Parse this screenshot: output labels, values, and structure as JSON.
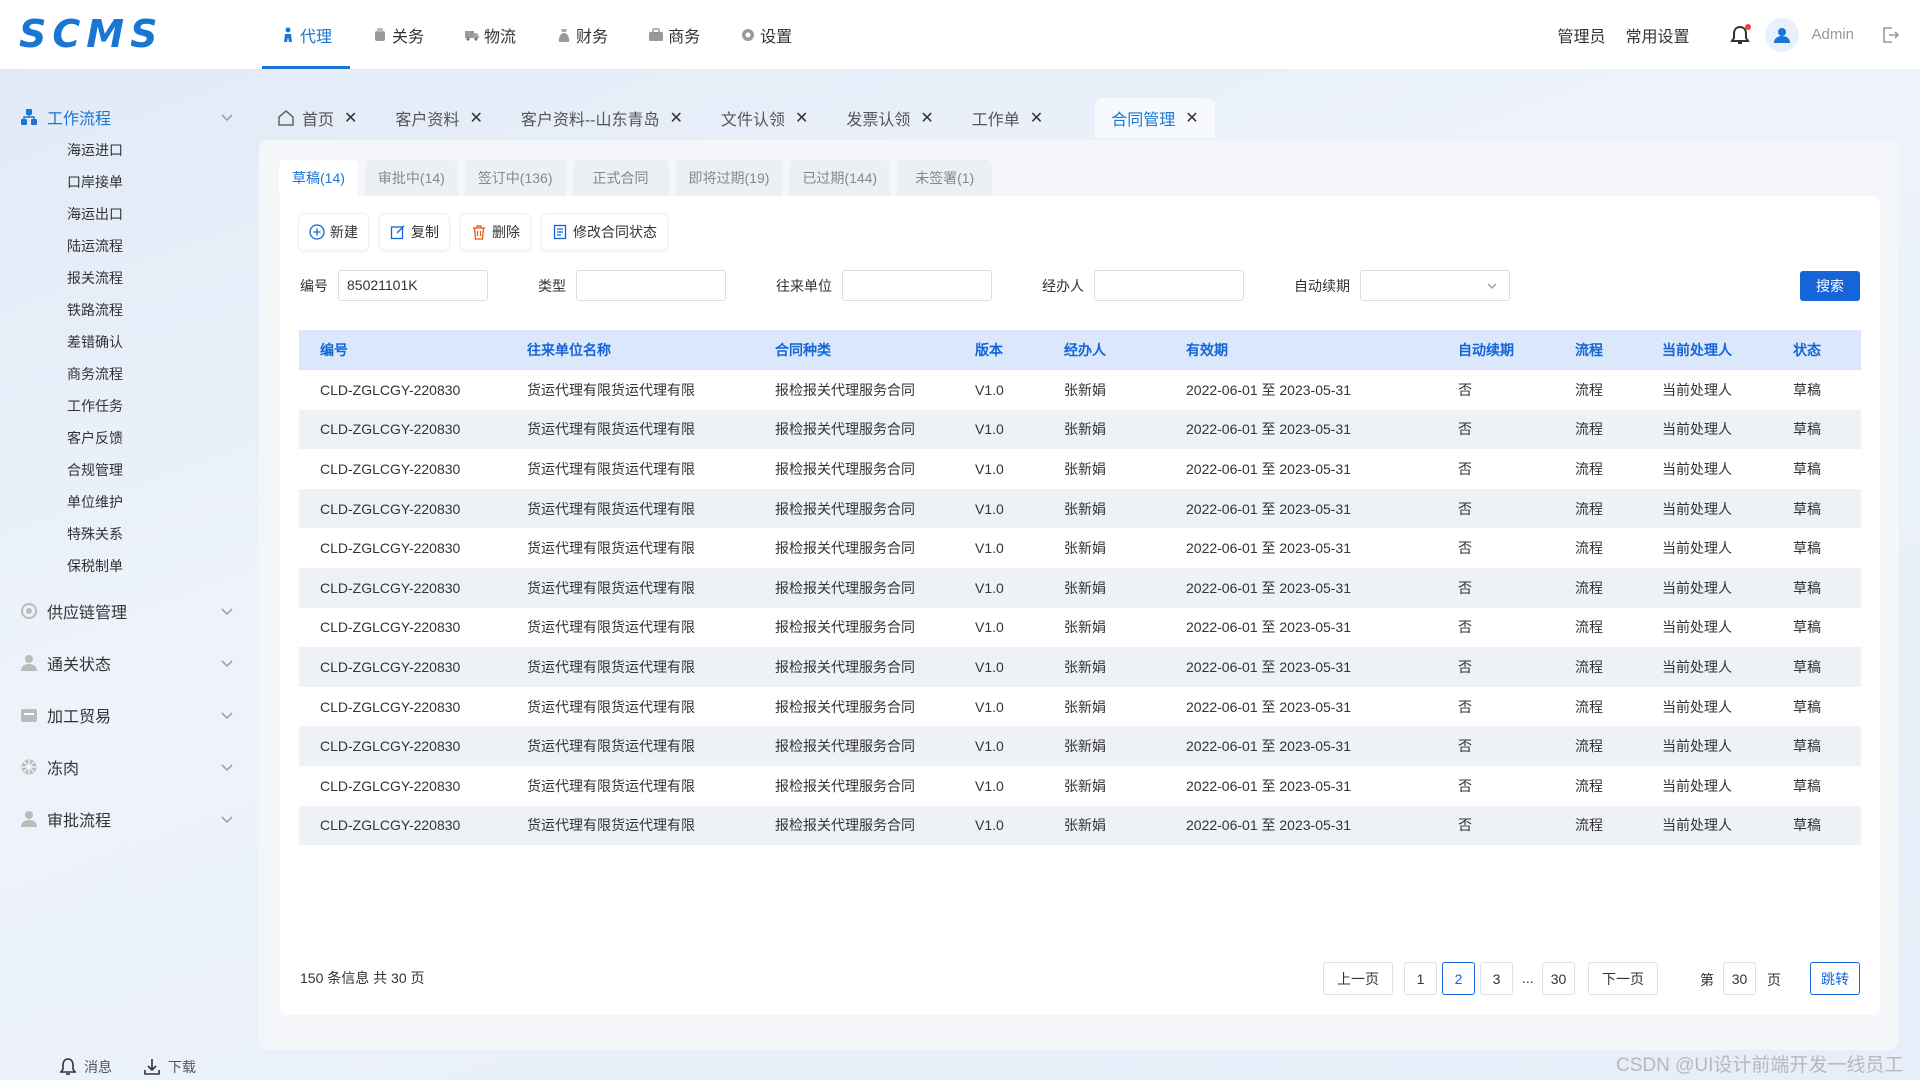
{
  "app": {
    "logo": "SCMS"
  },
  "topnav": [
    {
      "label": "代理",
      "icon": "agent-icon"
    },
    {
      "label": "关务",
      "icon": "customs-icon"
    },
    {
      "label": "物流",
      "icon": "truck-icon"
    },
    {
      "label": "财务",
      "icon": "finance-icon"
    },
    {
      "label": "商务",
      "icon": "briefcase-icon"
    },
    {
      "label": "设置",
      "icon": "gear-icon"
    }
  ],
  "header_right": {
    "admin_role": "管理员",
    "common_settings": "常用设置",
    "username": "Admin"
  },
  "sidebar": {
    "groups": [
      {
        "label": "工作流程",
        "icon": "workflow-icon"
      },
      {
        "label": "供应链管理",
        "icon": "supply-chain-icon"
      },
      {
        "label": "通关状态",
        "icon": "clearance-icon"
      },
      {
        "label": "加工贸易",
        "icon": "processing-trade-icon"
      },
      {
        "label": "冻肉",
        "icon": "frozen-meat-icon"
      },
      {
        "label": "审批流程",
        "icon": "approval-icon"
      }
    ],
    "workflow_items": [
      "海运进口",
      "口岸接单",
      "海运出口",
      "陆运流程",
      "报关流程",
      "铁路流程",
      "差错确认",
      "商务流程",
      "工作任务",
      "客户反馈",
      "合规管理",
      "单位维护",
      "特殊关系",
      "保税制单"
    ],
    "bottom": {
      "messages": "消息",
      "download": "下载"
    }
  },
  "page_tabs": [
    {
      "label": "首页"
    },
    {
      "label": "客户资料"
    },
    {
      "label": "客户资料--山东青岛"
    },
    {
      "label": "文件认领"
    },
    {
      "label": "发票认领"
    },
    {
      "label": "工作单"
    },
    {
      "label": "合同管理"
    }
  ],
  "status_tabs": [
    "草稿(14)",
    "审批中(14)",
    "签订中(136)",
    "正式合同",
    "即将过期(19)",
    "已过期(144)",
    "未签署(1)"
  ],
  "toolbar": {
    "new": "新建",
    "copy": "复制",
    "delete": "删除",
    "modify_status": "修改合同状态"
  },
  "filters": {
    "code_label": "编号",
    "code_value": "85021101K",
    "type_label": "类型",
    "type_value": "",
    "partner_label": "往来单位",
    "partner_value": "",
    "handler_label": "经办人",
    "handler_value": "",
    "auto_renew_label": "自动续期",
    "auto_renew_value": "",
    "search": "搜索"
  },
  "table": {
    "headers": [
      "编号",
      "往来单位名称",
      "合同种类",
      "版本",
      "经办人",
      "有效期",
      "自动续期",
      "流程",
      "当前处理人",
      "状态"
    ],
    "rows": [
      [
        "CLD-ZGLCGY-220830",
        "货运代理有限货运代理有限",
        "报检报关代理服务合同",
        "V1.0",
        "张新娟",
        "2022-06-01 至 2023-05-31",
        "否",
        "流程",
        "当前处理人",
        "草稿"
      ],
      [
        "CLD-ZGLCGY-220830",
        "货运代理有限货运代理有限",
        "报检报关代理服务合同",
        "V1.0",
        "张新娟",
        "2022-06-01 至 2023-05-31",
        "否",
        "流程",
        "当前处理人",
        "草稿"
      ],
      [
        "CLD-ZGLCGY-220830",
        "货运代理有限货运代理有限",
        "报检报关代理服务合同",
        "V1.0",
        "张新娟",
        "2022-06-01 至 2023-05-31",
        "否",
        "流程",
        "当前处理人",
        "草稿"
      ],
      [
        "CLD-ZGLCGY-220830",
        "货运代理有限货运代理有限",
        "报检报关代理服务合同",
        "V1.0",
        "张新娟",
        "2022-06-01 至 2023-05-31",
        "否",
        "流程",
        "当前处理人",
        "草稿"
      ],
      [
        "CLD-ZGLCGY-220830",
        "货运代理有限货运代理有限",
        "报检报关代理服务合同",
        "V1.0",
        "张新娟",
        "2022-06-01 至 2023-05-31",
        "否",
        "流程",
        "当前处理人",
        "草稿"
      ],
      [
        "CLD-ZGLCGY-220830",
        "货运代理有限货运代理有限",
        "报检报关代理服务合同",
        "V1.0",
        "张新娟",
        "2022-06-01 至 2023-05-31",
        "否",
        "流程",
        "当前处理人",
        "草稿"
      ],
      [
        "CLD-ZGLCGY-220830",
        "货运代理有限货运代理有限",
        "报检报关代理服务合同",
        "V1.0",
        "张新娟",
        "2022-06-01 至 2023-05-31",
        "否",
        "流程",
        "当前处理人",
        "草稿"
      ],
      [
        "CLD-ZGLCGY-220830",
        "货运代理有限货运代理有限",
        "报检报关代理服务合同",
        "V1.0",
        "张新娟",
        "2022-06-01 至 2023-05-31",
        "否",
        "流程",
        "当前处理人",
        "草稿"
      ],
      [
        "CLD-ZGLCGY-220830",
        "货运代理有限货运代理有限",
        "报检报关代理服务合同",
        "V1.0",
        "张新娟",
        "2022-06-01 至 2023-05-31",
        "否",
        "流程",
        "当前处理人",
        "草稿"
      ],
      [
        "CLD-ZGLCGY-220830",
        "货运代理有限货运代理有限",
        "报检报关代理服务合同",
        "V1.0",
        "张新娟",
        "2022-06-01 至 2023-05-31",
        "否",
        "流程",
        "当前处理人",
        "草稿"
      ],
      [
        "CLD-ZGLCGY-220830",
        "货运代理有限货运代理有限",
        "报检报关代理服务合同",
        "V1.0",
        "张新娟",
        "2022-06-01 至 2023-05-31",
        "否",
        "流程",
        "当前处理人",
        "草稿"
      ],
      [
        "CLD-ZGLCGY-220830",
        "货运代理有限货运代理有限",
        "报检报关代理服务合同",
        "V1.0",
        "张新娟",
        "2022-06-01 至 2023-05-31",
        "否",
        "流程",
        "当前处理人",
        "草稿"
      ]
    ]
  },
  "pagination": {
    "summary": "150 条信息 共 30 页",
    "prev": "上一页",
    "next": "下一页",
    "pages": [
      "1",
      "2",
      "3"
    ],
    "ellipsis": "...",
    "last": "30",
    "current": "2",
    "goto_prefix": "第",
    "goto_value": "30",
    "goto_suffix": "页",
    "goto_button": "跳转"
  },
  "watermark": "CSDN @UI设计前端开发一线员工",
  "colors": {
    "accent": "#1976d2",
    "button": "#1565d8",
    "header_row": "#dbe8fb"
  }
}
